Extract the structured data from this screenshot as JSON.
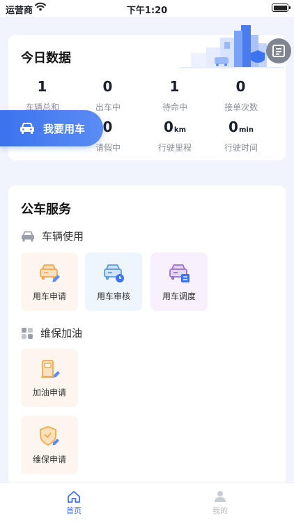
{
  "status_bar": {
    "carrier": "运营商",
    "time": "下午1:20"
  },
  "today": {
    "title": "今日数据",
    "stats": [
      {
        "value": "1",
        "unit": "",
        "label": "车辆总和"
      },
      {
        "value": "0",
        "unit": "",
        "label": "出车中"
      },
      {
        "value": "1",
        "unit": "",
        "label": "待命中"
      },
      {
        "value": "0",
        "unit": "",
        "label": "接单次数"
      },
      {
        "value": "0",
        "unit": "",
        "label": "请假中"
      },
      {
        "value": "0",
        "unit": "km",
        "label": "行驶里程"
      },
      {
        "value": "0",
        "unit": "min",
        "label": "行驶时间"
      }
    ],
    "cta_label": "我要用车"
  },
  "service": {
    "title": "公车服务",
    "vehicle_section": {
      "label": "车辆使用",
      "items": [
        {
          "label": "用车申请",
          "icon": "car-edit-icon"
        },
        {
          "label": "用车审核",
          "icon": "car-clock-icon"
        },
        {
          "label": "用车调度",
          "icon": "car-list-icon"
        }
      ]
    },
    "maintenance_section": {
      "label": "维保加油",
      "items": [
        {
          "label": "加油申请",
          "icon": "fuel-pump-icon"
        },
        {
          "label": "维保申请",
          "icon": "shield-edit-icon"
        }
      ]
    }
  },
  "tabbar": {
    "home_label": "首页",
    "mine_label": "我的"
  },
  "colors": {
    "accent": "#3c73ee",
    "orange": "#f3a84a",
    "blue": "#5b9be6",
    "purple": "#9b6ed6",
    "inactive": "#b8bcc4"
  }
}
